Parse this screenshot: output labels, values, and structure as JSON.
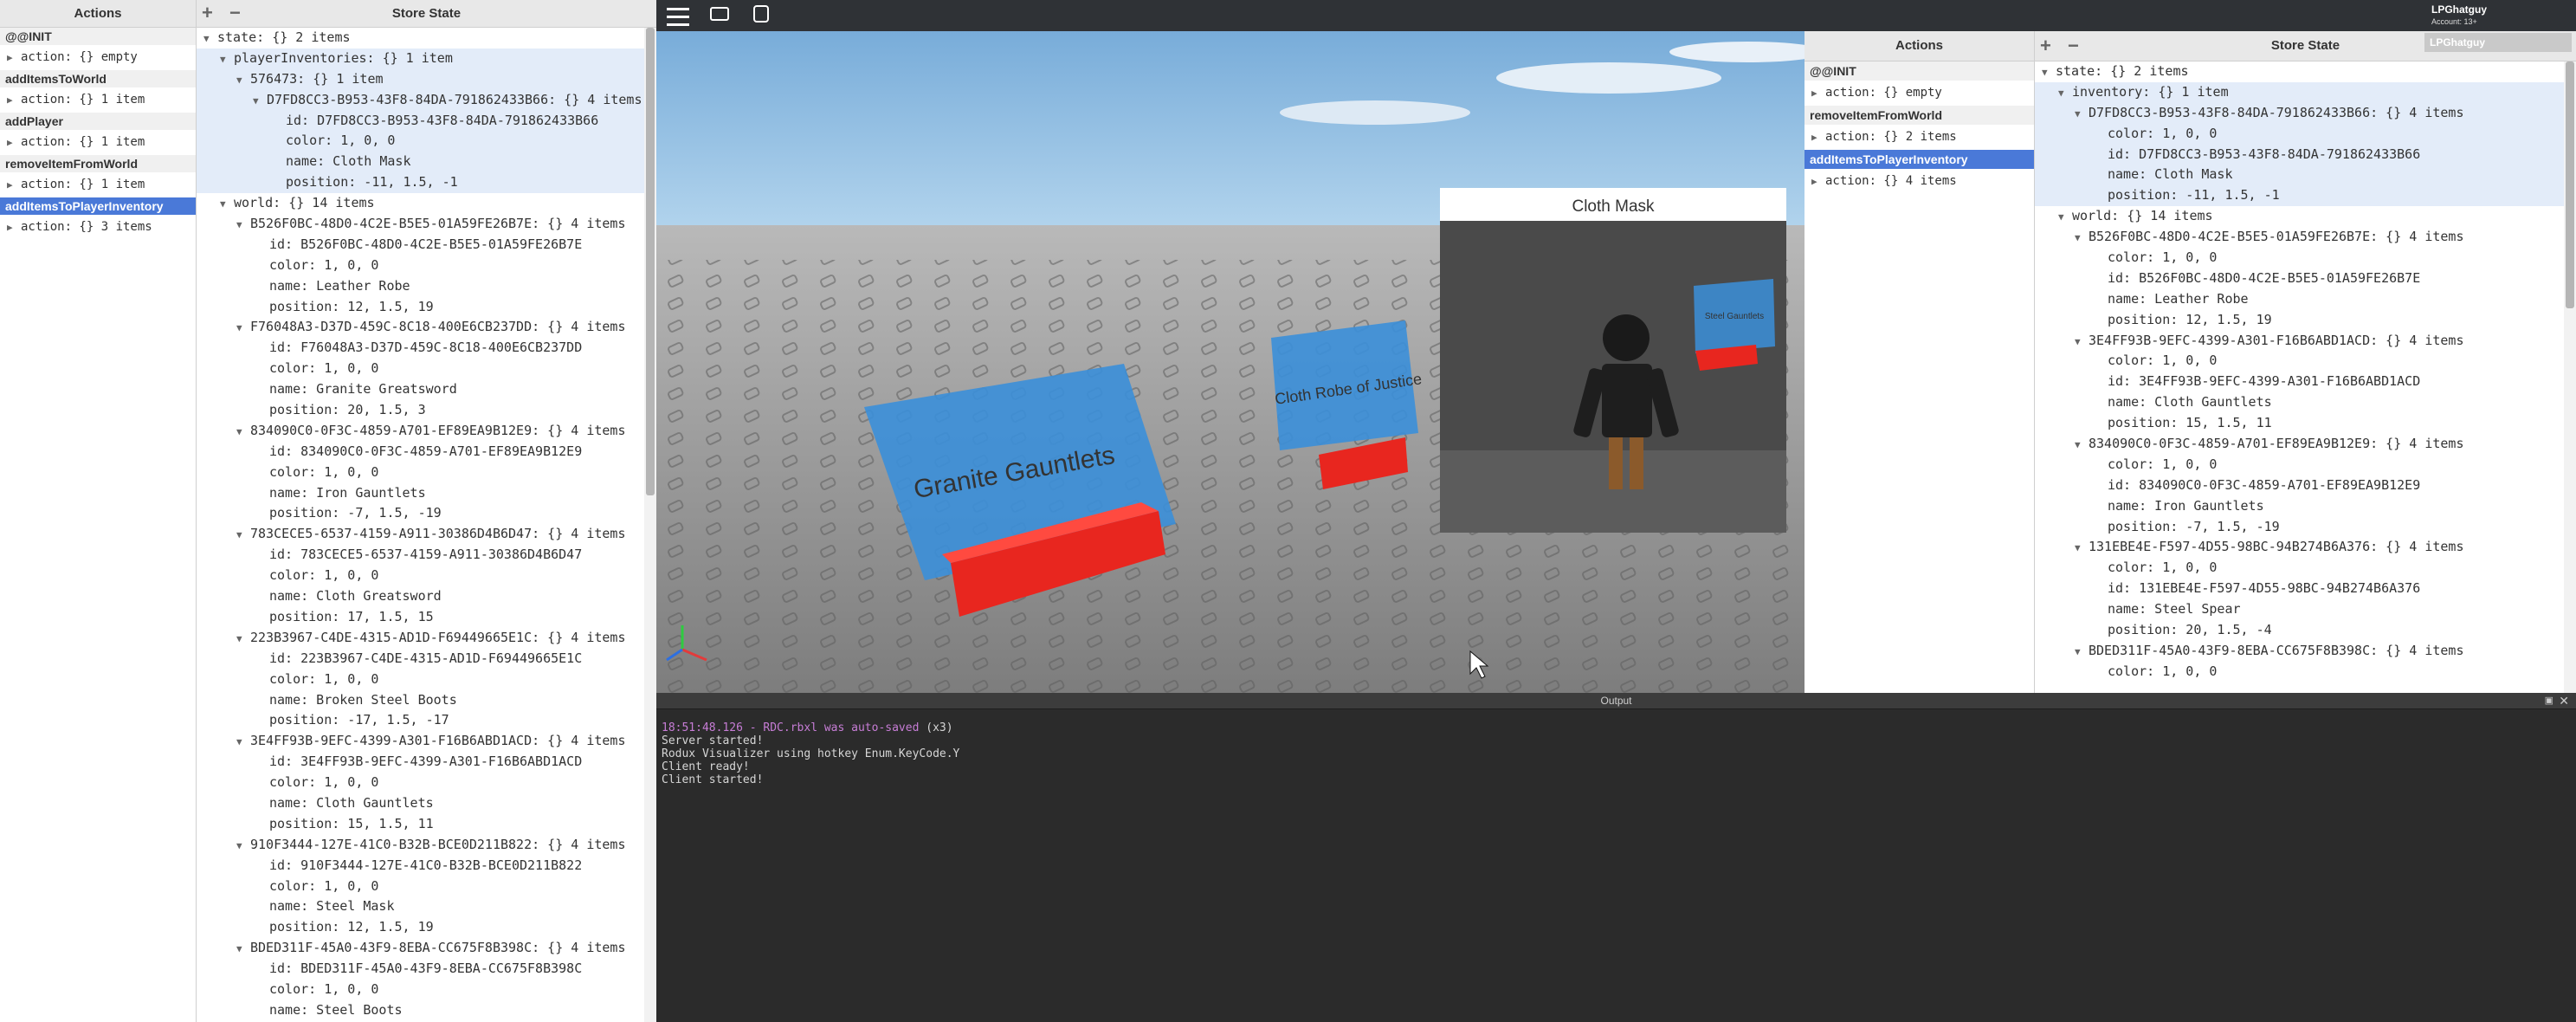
{
  "left": {
    "actions_header": "Actions",
    "state_header": "Store State",
    "actions": [
      {
        "title": "@@INIT",
        "detail": "action: {} empty",
        "selected": false
      },
      {
        "title": "addItemsToWorld",
        "detail": "action: {} 1 item",
        "selected": false
      },
      {
        "title": "addPlayer",
        "detail": "action: {} 1 item",
        "selected": false
      },
      {
        "title": "removeItemFromWorld",
        "detail": "action: {} 1 item",
        "selected": false
      },
      {
        "title": "addItemsToPlayerInventory",
        "detail": "action: {} 3 items",
        "selected": true
      }
    ],
    "tree": [
      {
        "t": "state: {} 2 items",
        "tri": "▼",
        "indent": 0,
        "hl": false
      },
      {
        "t": "playerInventories: {} 1 item",
        "tri": "▼",
        "indent": 1,
        "hl": true
      },
      {
        "t": "576473: {} 1 item",
        "tri": "▼",
        "indent": 2,
        "hl": true
      },
      {
        "t": "D7FD8CC3-B953-43F8-84DA-791862433B66: {} 4 items",
        "tri": "▼",
        "indent": 3,
        "hl": true
      },
      {
        "t": "id: D7FD8CC3-B953-43F8-84DA-791862433B66",
        "tri": "",
        "indent": 4,
        "hl": true
      },
      {
        "t": "color: 1, 0, 0",
        "tri": "",
        "indent": 4,
        "hl": true
      },
      {
        "t": "name: Cloth Mask",
        "tri": "",
        "indent": 4,
        "hl": true
      },
      {
        "t": "position: -11, 1.5, -1",
        "tri": "",
        "indent": 4,
        "hl": true
      },
      {
        "t": "world: {} 14 items",
        "tri": "▼",
        "indent": 1,
        "hl": false
      },
      {
        "t": "B526F0BC-48D0-4C2E-B5E5-01A59FE26B7E: {} 4 items",
        "tri": "▼",
        "indent": 2,
        "hl": false
      },
      {
        "t": "id: B526F0BC-48D0-4C2E-B5E5-01A59FE26B7E",
        "tri": "",
        "indent": 3,
        "hl": false
      },
      {
        "t": "color: 1, 0, 0",
        "tri": "",
        "indent": 3,
        "hl": false
      },
      {
        "t": "name: Leather Robe",
        "tri": "",
        "indent": 3,
        "hl": false
      },
      {
        "t": "position: 12, 1.5, 19",
        "tri": "",
        "indent": 3,
        "hl": false
      },
      {
        "t": "F76048A3-D37D-459C-8C18-400E6CB237DD: {} 4 items",
        "tri": "▼",
        "indent": 2,
        "hl": false
      },
      {
        "t": "id: F76048A3-D37D-459C-8C18-400E6CB237DD",
        "tri": "",
        "indent": 3,
        "hl": false
      },
      {
        "t": "color: 1, 0, 0",
        "tri": "",
        "indent": 3,
        "hl": false
      },
      {
        "t": "name: Granite Greatsword",
        "tri": "",
        "indent": 3,
        "hl": false
      },
      {
        "t": "position: 20, 1.5, 3",
        "tri": "",
        "indent": 3,
        "hl": false
      },
      {
        "t": "834090C0-0F3C-4859-A701-EF89EA9B12E9: {} 4 items",
        "tri": "▼",
        "indent": 2,
        "hl": false
      },
      {
        "t": "id: 834090C0-0F3C-4859-A701-EF89EA9B12E9",
        "tri": "",
        "indent": 3,
        "hl": false
      },
      {
        "t": "color: 1, 0, 0",
        "tri": "",
        "indent": 3,
        "hl": false
      },
      {
        "t": "name: Iron Gauntlets",
        "tri": "",
        "indent": 3,
        "hl": false
      },
      {
        "t": "position: -7, 1.5, -19",
        "tri": "",
        "indent": 3,
        "hl": false
      },
      {
        "t": "783CECE5-6537-4159-A911-30386D4B6D47: {} 4 items",
        "tri": "▼",
        "indent": 2,
        "hl": false
      },
      {
        "t": "id: 783CECE5-6537-4159-A911-30386D4B6D47",
        "tri": "",
        "indent": 3,
        "hl": false
      },
      {
        "t": "color: 1, 0, 0",
        "tri": "",
        "indent": 3,
        "hl": false
      },
      {
        "t": "name: Cloth Greatsword",
        "tri": "",
        "indent": 3,
        "hl": false
      },
      {
        "t": "position: 17, 1.5, 15",
        "tri": "",
        "indent": 3,
        "hl": false
      },
      {
        "t": "223B3967-C4DE-4315-AD1D-F69449665E1C: {} 4 items",
        "tri": "▼",
        "indent": 2,
        "hl": false
      },
      {
        "t": "id: 223B3967-C4DE-4315-AD1D-F69449665E1C",
        "tri": "",
        "indent": 3,
        "hl": false
      },
      {
        "t": "color: 1, 0, 0",
        "tri": "",
        "indent": 3,
        "hl": false
      },
      {
        "t": "name: Broken Steel Boots",
        "tri": "",
        "indent": 3,
        "hl": false
      },
      {
        "t": "position: -17, 1.5, -17",
        "tri": "",
        "indent": 3,
        "hl": false
      },
      {
        "t": "3E4FF93B-9EFC-4399-A301-F16B6ABD1ACD: {} 4 items",
        "tri": "▼",
        "indent": 2,
        "hl": false
      },
      {
        "t": "id: 3E4FF93B-9EFC-4399-A301-F16B6ABD1ACD",
        "tri": "",
        "indent": 3,
        "hl": false
      },
      {
        "t": "color: 1, 0, 0",
        "tri": "",
        "indent": 3,
        "hl": false
      },
      {
        "t": "name: Cloth Gauntlets",
        "tri": "",
        "indent": 3,
        "hl": false
      },
      {
        "t": "position: 15, 1.5, 11",
        "tri": "",
        "indent": 3,
        "hl": false
      },
      {
        "t": "910F3444-127E-41C0-B32B-BCE0D211B822: {} 4 items",
        "tri": "▼",
        "indent": 2,
        "hl": false
      },
      {
        "t": "id: 910F3444-127E-41C0-B32B-BCE0D211B822",
        "tri": "",
        "indent": 3,
        "hl": false
      },
      {
        "t": "color: 1, 0, 0",
        "tri": "",
        "indent": 3,
        "hl": false
      },
      {
        "t": "name: Steel Mask",
        "tri": "",
        "indent": 3,
        "hl": false
      },
      {
        "t": "position: 12, 1.5, 19",
        "tri": "",
        "indent": 3,
        "hl": false
      },
      {
        "t": "BDED311F-45A0-43F9-8EBA-CC675F8B398C: {} 4 items",
        "tri": "▼",
        "indent": 2,
        "hl": false
      },
      {
        "t": "id: BDED311F-45A0-43F9-8EBA-CC675F8B398C",
        "tri": "",
        "indent": 3,
        "hl": false
      },
      {
        "t": "color: 1, 0, 0",
        "tri": "",
        "indent": 3,
        "hl": false
      },
      {
        "t": "name: Steel Boots",
        "tri": "",
        "indent": 3,
        "hl": false
      }
    ]
  },
  "game": {
    "account_name": "LPGhatguy",
    "account_sub": "Account: 13+",
    "account_box": "LPGhatguy",
    "preview_title": "Cloth Mask",
    "sign_granite": "Granite Gauntlets",
    "sign_cloth_robe": "Cloth Robe of Justice",
    "sign_preview": "Steel Gauntlets"
  },
  "right": {
    "actions_header": "Actions",
    "state_header": "Store State",
    "actions": [
      {
        "title": "@@INIT",
        "detail": "action: {} empty",
        "selected": false
      },
      {
        "title": "removeItemFromWorld",
        "detail": "action: {} 2 items",
        "selected": false
      },
      {
        "title": "addItemsToPlayerInventory",
        "detail": "action: {} 4 items",
        "selected": true
      }
    ],
    "tree": [
      {
        "t": "state: {} 2 items",
        "tri": "▼",
        "indent": 0,
        "hl": false
      },
      {
        "t": "inventory: {} 1 item",
        "tri": "▼",
        "indent": 1,
        "hl": true
      },
      {
        "t": "D7FD8CC3-B953-43F8-84DA-791862433B66: {} 4 items",
        "tri": "▼",
        "indent": 2,
        "hl": true
      },
      {
        "t": "color: 1, 0, 0",
        "tri": "",
        "indent": 3,
        "hl": true
      },
      {
        "t": "id: D7FD8CC3-B953-43F8-84DA-791862433B66",
        "tri": "",
        "indent": 3,
        "hl": true
      },
      {
        "t": "name: Cloth Mask",
        "tri": "",
        "indent": 3,
        "hl": true
      },
      {
        "t": "position: -11, 1.5, -1",
        "tri": "",
        "indent": 3,
        "hl": true
      },
      {
        "t": "world: {} 14 items",
        "tri": "▼",
        "indent": 1,
        "hl": false
      },
      {
        "t": "B526F0BC-48D0-4C2E-B5E5-01A59FE26B7E: {} 4 items",
        "tri": "▼",
        "indent": 2,
        "hl": false
      },
      {
        "t": "color: 1, 0, 0",
        "tri": "",
        "indent": 3,
        "hl": false
      },
      {
        "t": "id: B526F0BC-48D0-4C2E-B5E5-01A59FE26B7E",
        "tri": "",
        "indent": 3,
        "hl": false
      },
      {
        "t": "name: Leather Robe",
        "tri": "",
        "indent": 3,
        "hl": false
      },
      {
        "t": "position: 12, 1.5, 19",
        "tri": "",
        "indent": 3,
        "hl": false
      },
      {
        "t": "3E4FF93B-9EFC-4399-A301-F16B6ABD1ACD: {} 4 items",
        "tri": "▼",
        "indent": 2,
        "hl": false
      },
      {
        "t": "color: 1, 0, 0",
        "tri": "",
        "indent": 3,
        "hl": false
      },
      {
        "t": "id: 3E4FF93B-9EFC-4399-A301-F16B6ABD1ACD",
        "tri": "",
        "indent": 3,
        "hl": false
      },
      {
        "t": "name: Cloth Gauntlets",
        "tri": "",
        "indent": 3,
        "hl": false
      },
      {
        "t": "position: 15, 1.5, 11",
        "tri": "",
        "indent": 3,
        "hl": false
      },
      {
        "t": "834090C0-0F3C-4859-A701-EF89EA9B12E9: {} 4 items",
        "tri": "▼",
        "indent": 2,
        "hl": false
      },
      {
        "t": "color: 1, 0, 0",
        "tri": "",
        "indent": 3,
        "hl": false
      },
      {
        "t": "id: 834090C0-0F3C-4859-A701-EF89EA9B12E9",
        "tri": "",
        "indent": 3,
        "hl": false
      },
      {
        "t": "name: Iron Gauntlets",
        "tri": "",
        "indent": 3,
        "hl": false
      },
      {
        "t": "position: -7, 1.5, -19",
        "tri": "",
        "indent": 3,
        "hl": false
      },
      {
        "t": "131EBE4E-F597-4D55-98BC-94B274B6A376: {} 4 items",
        "tri": "▼",
        "indent": 2,
        "hl": false
      },
      {
        "t": "color: 1, 0, 0",
        "tri": "",
        "indent": 3,
        "hl": false
      },
      {
        "t": "id: 131EBE4E-F597-4D55-98BC-94B274B6A376",
        "tri": "",
        "indent": 3,
        "hl": false
      },
      {
        "t": "name: Steel Spear",
        "tri": "",
        "indent": 3,
        "hl": false
      },
      {
        "t": "position: 20, 1.5, -4",
        "tri": "",
        "indent": 3,
        "hl": false
      },
      {
        "t": "BDED311F-45A0-43F9-8EBA-CC675F8B398C: {} 4 items",
        "tri": "▼",
        "indent": 2,
        "hl": false
      },
      {
        "t": "color: 1, 0, 0",
        "tri": "",
        "indent": 3,
        "hl": false
      }
    ]
  },
  "output": {
    "title": "Output",
    "first_time": "18:51:48.126",
    "first_msg": " - RDC.rbxl was auto-saved",
    "first_count": " (x3)",
    "lines": [
      "Server started!",
      "Rodux Visualizer using hotkey Enum.KeyCode.Y",
      "Client ready!",
      "Client started!"
    ]
  },
  "colors": {
    "selection": "#4a79d8",
    "sign_blue": "#3b8fd9",
    "pad_red": "#e8261f",
    "autosave_purple": "#c77dd6"
  }
}
